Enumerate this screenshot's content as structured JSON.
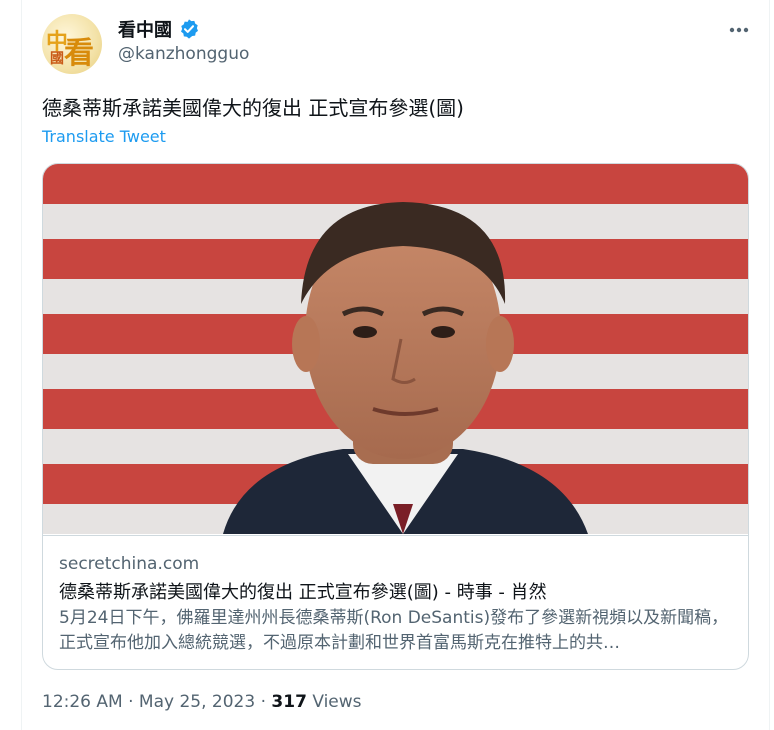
{
  "author": {
    "display_name": "看中國",
    "handle": "@kanzhongguo",
    "avatar_text": "中國看",
    "verified": true
  },
  "tweet": {
    "text": "德桑蒂斯承諾美國偉大的復出 正式宣布參選(圖)",
    "translate_label": "Translate Tweet"
  },
  "card": {
    "domain": "secretchina.com",
    "title": "德桑蒂斯承諾美國偉大的復出 正式宣布參選(圖) - 時事 - 肖然",
    "description": "5月24日下午，佛羅里達州州長德桑蒂斯(Ron DeSantis)發布了參選新視頻以及新聞稿，正式宣布他加入總統競選，不過原本計劃和世界首富馬斯克在推特上的共…"
  },
  "meta": {
    "time": "12:26 AM",
    "separator1": "·",
    "date": "May 25, 2023",
    "separator2": "·",
    "views_count": "317",
    "views_label": "Views"
  },
  "colors": {
    "link": "#1d9bf0",
    "verified": "#1d9bf0",
    "secondary_text": "#536471",
    "border": "#cfd9de"
  },
  "icons": {
    "verified": "verified-badge-icon",
    "more": "more-dots-icon"
  }
}
